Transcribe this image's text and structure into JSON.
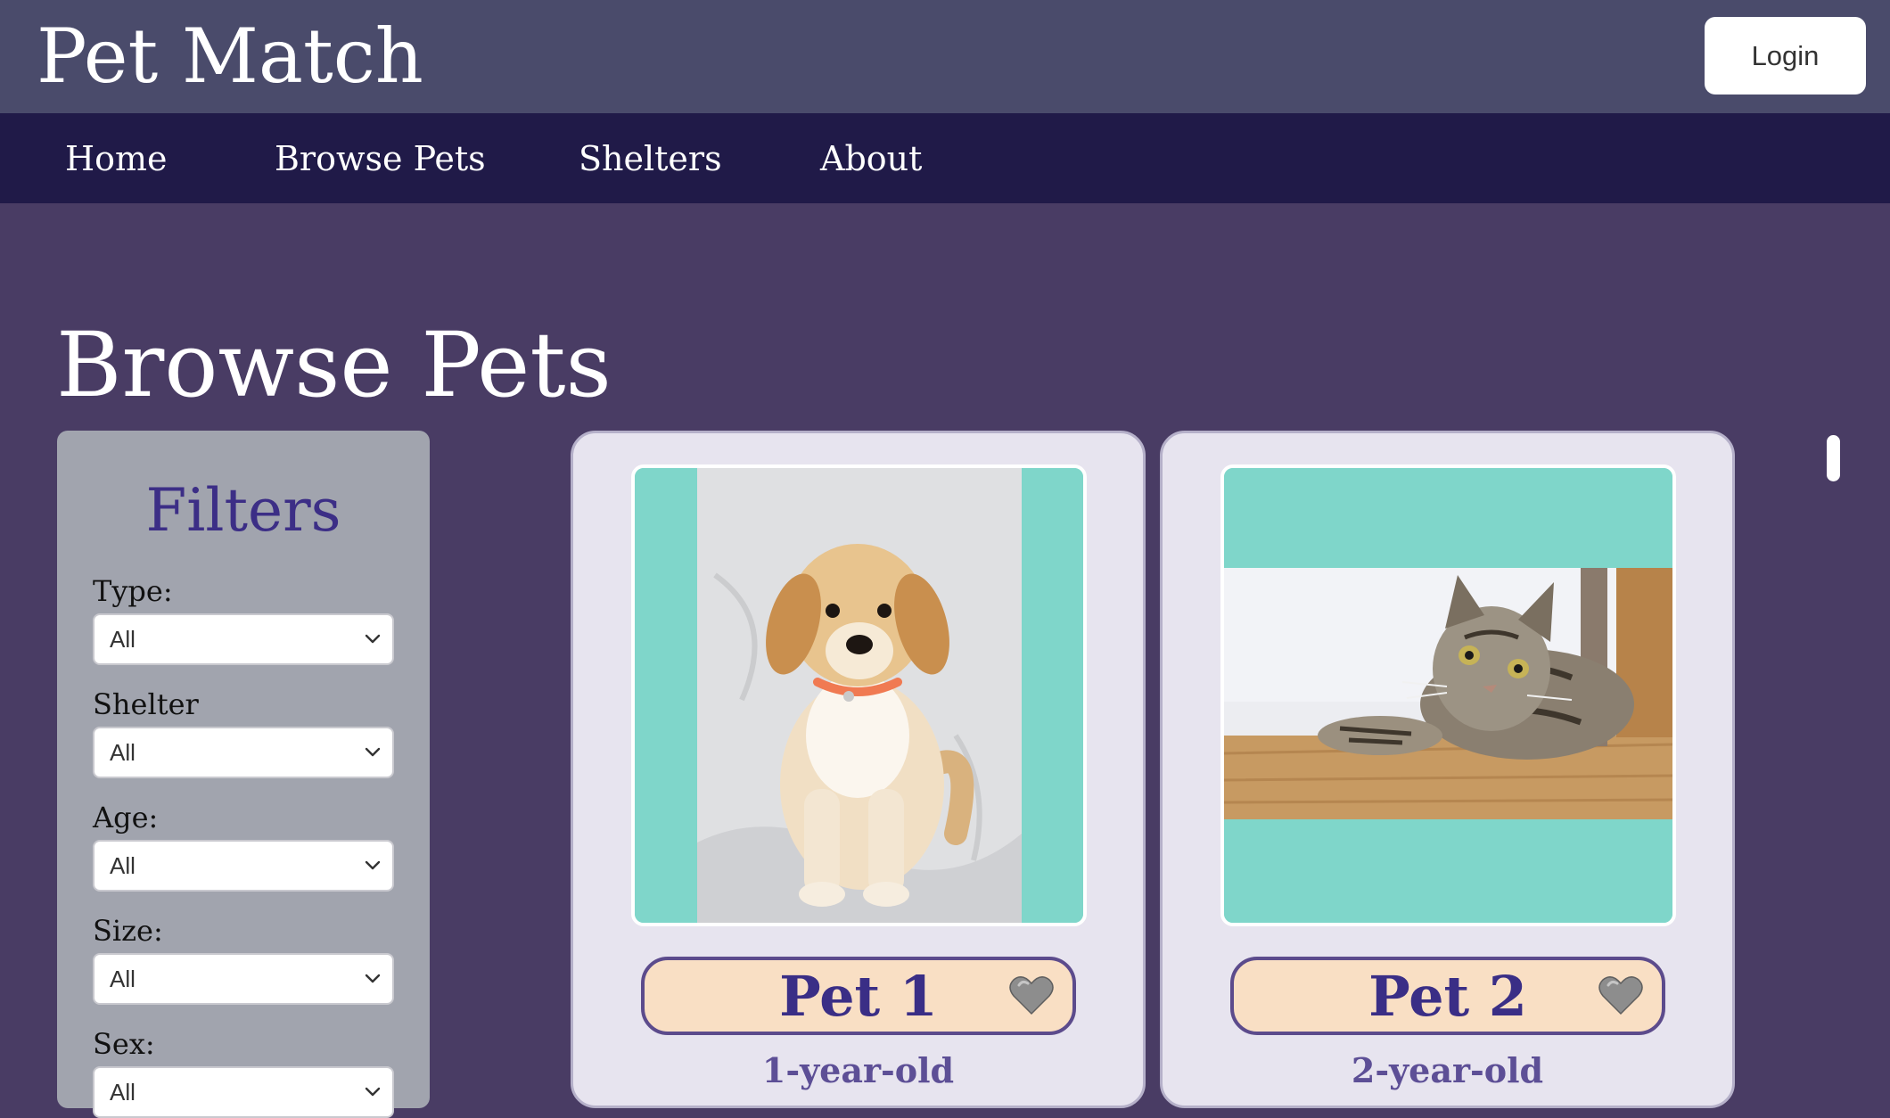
{
  "header": {
    "brand": "Pet Match",
    "login_label": "Login"
  },
  "nav": {
    "items": [
      {
        "label": "Home"
      },
      {
        "label": "Browse Pets"
      },
      {
        "label": "Shelters"
      },
      {
        "label": "About"
      }
    ]
  },
  "main": {
    "title": "Browse Pets"
  },
  "filters": {
    "title": "Filters",
    "fields": [
      {
        "label": "Type:",
        "value": "All"
      },
      {
        "label": "Shelter",
        "value": "All"
      },
      {
        "label": "Age:",
        "value": "All"
      },
      {
        "label": "Size:",
        "value": "All"
      },
      {
        "label": "Sex:",
        "value": "All"
      }
    ]
  },
  "pets": [
    {
      "name": "Pet 1",
      "age": "1-year-old",
      "photo_icon": "puppy-photo"
    },
    {
      "name": "Pet 2",
      "age": "2-year-old",
      "photo_icon": "cat-photo"
    }
  ],
  "colors": {
    "header_bg": "#4a4b6b",
    "nav_bg": "#201a48",
    "page_bg": "#493c64",
    "accent_teal": "#7fd6ca",
    "pill_bg": "#f9dfc4",
    "title_purple": "#3a2e86"
  }
}
